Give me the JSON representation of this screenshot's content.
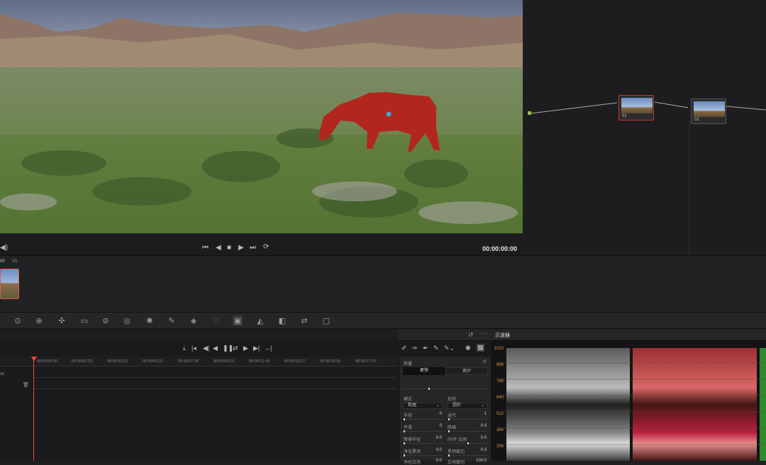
{
  "transport": {
    "timecode": "00:00:00:00"
  },
  "nodes": [
    {
      "label": "01"
    },
    {
      "label": "02"
    }
  ],
  "clips": {
    "tc": "00",
    "track": "V1"
  },
  "timeline": {
    "ruler": [
      "00:00:00:00",
      "00:00:01:23",
      "00:00:03:22",
      "00:00:05:21",
      "00:00:07:20",
      "00:00:09:19",
      "00:00:11:18",
      "00:00:13:17",
      "00:00:15:16",
      "00:00:17:15"
    ],
    "track_label": "ck"
  },
  "qualifier": {
    "header": "质量",
    "btn_fast": "更快",
    "btn_better": "更好",
    "mode_label": "模式",
    "shape_label": "形状",
    "mode_value": "数据",
    "shape_value": "圆形",
    "rows": [
      {
        "l1": "半径",
        "v1": "0",
        "l2": "迭代",
        "v2": "1"
      },
      {
        "l1": "平滑",
        "v1": "0",
        "l2": "降噪",
        "v2": "0.0"
      },
      {
        "l1": "降噪半径",
        "v1": "0.0",
        "l2": "内/外 比例",
        "v2": "0.0"
      },
      {
        "l1": "净化黑场",
        "v1": "0.0",
        "l2": "黑场裁切",
        "v2": "0.0"
      },
      {
        "l1": "净化白场",
        "v1": "0.0",
        "l2": "白场裁切",
        "v2": "100.0"
      }
    ]
  },
  "scopes": {
    "title": "示波器",
    "scale": [
      "1023",
      "896",
      "768",
      "640",
      "512",
      "384",
      "256"
    ]
  },
  "colors": {
    "accent": "#e6463c",
    "node_dot": "#3aa7e0",
    "matte": "#b3261e"
  }
}
